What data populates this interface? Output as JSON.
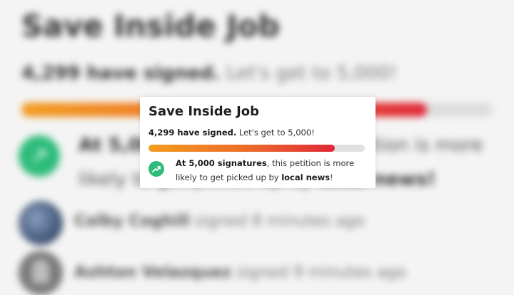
{
  "background": {
    "title": "Save Inside Job",
    "signed_bold": "4,299 have signed.",
    "signed_rest": "Let's get to 5,000!",
    "progress": 0.86,
    "note_bold": "At 5,000 signatures,",
    "note_rest": "this petition is more likely to get picked up by",
    "note_end": "local news!",
    "signers": [
      {
        "name": "Colby Coghill",
        "action": "signed 8 minutes ago"
      },
      {
        "name": "Ashton Velazquez",
        "action": "signed 9 minutes ago"
      }
    ]
  },
  "card": {
    "title": "Save Inside Job",
    "signed_bold": "4,299 have signed.",
    "signed_rest": "Let's get to 5,000!",
    "progress": 0.86,
    "msg_bold1": "At 5,000 signatures",
    "msg_mid": ", this petition is more likely to get picked up by",
    "msg_bold2": "local news",
    "msg_end": "!",
    "icon": "trending-up-icon"
  },
  "colors": {
    "accent_green": "#2ebc7a",
    "progress_start": "#f39c1f",
    "progress_end": "#df2738"
  }
}
